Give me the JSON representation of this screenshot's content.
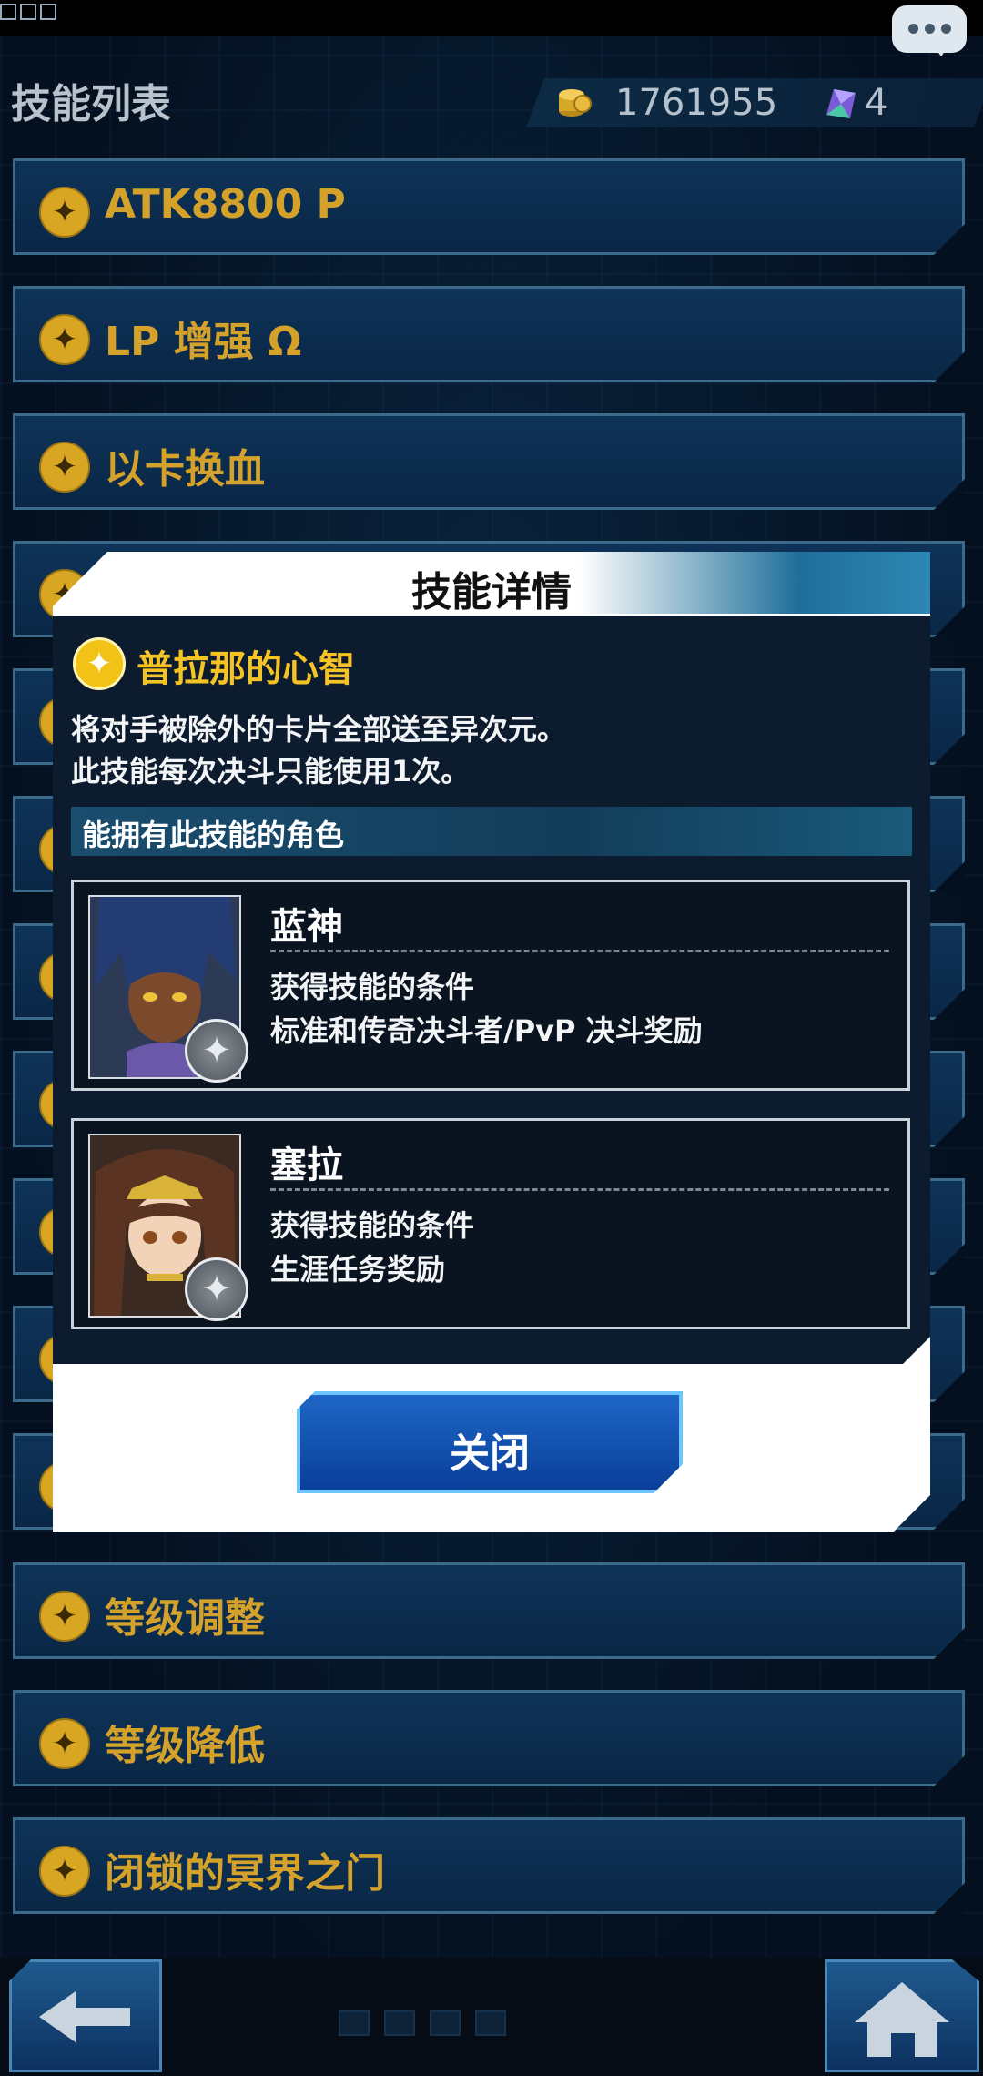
{
  "header": {
    "title": "技能列表",
    "coins": "1761955",
    "gems": "4"
  },
  "skill_list": [
    {
      "label": "ATK8800 P"
    },
    {
      "label": "LP 增强 Ω"
    },
    {
      "label": "以卡换血"
    },
    {
      "label": "等级调整"
    },
    {
      "label": "等级降低"
    },
    {
      "label": "闭锁的冥界之门"
    }
  ],
  "modal": {
    "title": "技能详情",
    "skill_name": "普拉那的心智",
    "desc_line1": "将对手被除外的卡片全部送至异次元。",
    "desc_line2": "此技能每次决斗只能使用1次。",
    "section_label": "能拥有此技能的角色",
    "characters": [
      {
        "name": "蓝神",
        "condition_label": "获得技能的条件",
        "condition_value": "标准和传奇决斗者/PvP 决斗奖励"
      },
      {
        "name": "塞拉",
        "condition_label": "获得技能的条件",
        "condition_value": "生涯任务奖励"
      }
    ],
    "close_label": "关闭"
  },
  "icons": {
    "coin": "coin-stack-icon",
    "gem": "gem-icon",
    "skill": "star-icon",
    "back": "arrow-left-icon",
    "home": "home-icon",
    "chat": "chat-icon"
  },
  "colors": {
    "skill_gold": "#d4a12a",
    "skill_name_yellow": "#f6c324",
    "close_button": "#1d66c6"
  }
}
